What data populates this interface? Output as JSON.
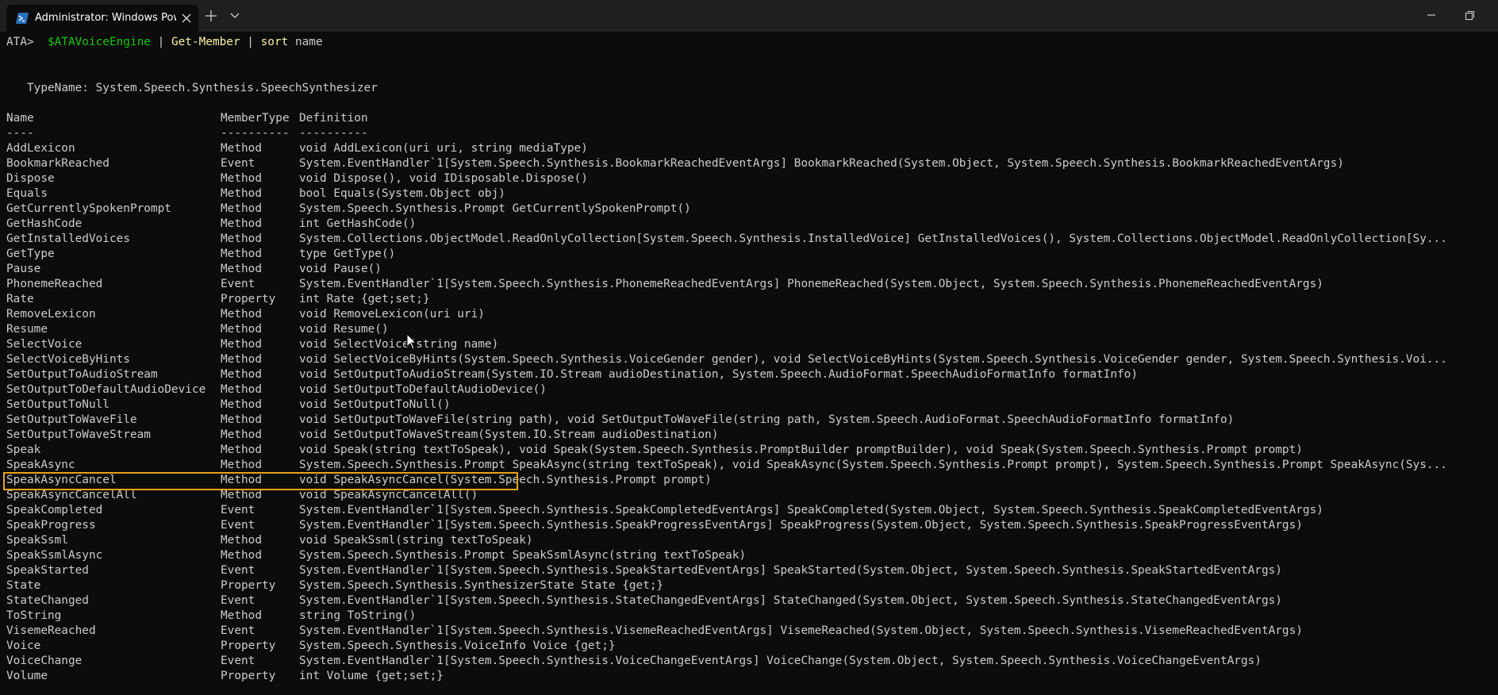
{
  "window": {
    "tab_title": "Administrator: Windows PowerShell",
    "icons": {
      "tab": "powershell-icon",
      "close_tab": "close-icon",
      "new_tab": "plus-icon",
      "dropdown": "chevron-down-icon",
      "minimize": "minimize-icon",
      "maximize": "maximize-icon"
    }
  },
  "command": {
    "prompt": "ATA>",
    "variable": "$ATAVoiceEngine",
    "pipe1": "|",
    "cmdlet1": "Get-Member",
    "pipe2": "|",
    "cmdlet2": "sort",
    "argument": "name"
  },
  "output": {
    "typename": "TypeName: System.Speech.Synthesis.SpeechSynthesizer",
    "headers": {
      "name": "Name",
      "type": "MemberType",
      "definition": "Definition"
    },
    "separators": {
      "name": "----",
      "type": "----------",
      "definition": "----------"
    },
    "rows": [
      {
        "name": "AddLexicon",
        "type": "Method",
        "definition": "void AddLexicon(uri uri, string mediaType)"
      },
      {
        "name": "BookmarkReached",
        "type": "Event",
        "definition": "System.EventHandler`1[System.Speech.Synthesis.BookmarkReachedEventArgs] BookmarkReached(System.Object, System.Speech.Synthesis.BookmarkReachedEventArgs)"
      },
      {
        "name": "Dispose",
        "type": "Method",
        "definition": "void Dispose(), void IDisposable.Dispose()"
      },
      {
        "name": "Equals",
        "type": "Method",
        "definition": "bool Equals(System.Object obj)"
      },
      {
        "name": "GetCurrentlySpokenPrompt",
        "type": "Method",
        "definition": "System.Speech.Synthesis.Prompt GetCurrentlySpokenPrompt()"
      },
      {
        "name": "GetHashCode",
        "type": "Method",
        "definition": "int GetHashCode()"
      },
      {
        "name": "GetInstalledVoices",
        "type": "Method",
        "definition": "System.Collections.ObjectModel.ReadOnlyCollection[System.Speech.Synthesis.InstalledVoice] GetInstalledVoices(), System.Collections.ObjectModel.ReadOnlyCollection[Sy..."
      },
      {
        "name": "GetType",
        "type": "Method",
        "definition": "type GetType()"
      },
      {
        "name": "Pause",
        "type": "Method",
        "definition": "void Pause()"
      },
      {
        "name": "PhonemeReached",
        "type": "Event",
        "definition": "System.EventHandler`1[System.Speech.Synthesis.PhonemeReachedEventArgs] PhonemeReached(System.Object, System.Speech.Synthesis.PhonemeReachedEventArgs)"
      },
      {
        "name": "Rate",
        "type": "Property",
        "definition": "int Rate {get;set;}"
      },
      {
        "name": "RemoveLexicon",
        "type": "Method",
        "definition": "void RemoveLexicon(uri uri)"
      },
      {
        "name": "Resume",
        "type": "Method",
        "definition": "void Resume()"
      },
      {
        "name": "SelectVoice",
        "type": "Method",
        "definition": "void SelectVoice(string name)"
      },
      {
        "name": "SelectVoiceByHints",
        "type": "Method",
        "definition": "void SelectVoiceByHints(System.Speech.Synthesis.VoiceGender gender), void SelectVoiceByHints(System.Speech.Synthesis.VoiceGender gender, System.Speech.Synthesis.Voi..."
      },
      {
        "name": "SetOutputToAudioStream",
        "type": "Method",
        "definition": "void SetOutputToAudioStream(System.IO.Stream audioDestination, System.Speech.AudioFormat.SpeechAudioFormatInfo formatInfo)"
      },
      {
        "name": "SetOutputToDefaultAudioDevice",
        "type": "Method",
        "definition": "void SetOutputToDefaultAudioDevice()"
      },
      {
        "name": "SetOutputToNull",
        "type": "Method",
        "definition": "void SetOutputToNull()"
      },
      {
        "name": "SetOutputToWaveFile",
        "type": "Method",
        "definition": "void SetOutputToWaveFile(string path), void SetOutputToWaveFile(string path, System.Speech.AudioFormat.SpeechAudioFormatInfo formatInfo)"
      },
      {
        "name": "SetOutputToWaveStream",
        "type": "Method",
        "definition": "void SetOutputToWaveStream(System.IO.Stream audioDestination)"
      },
      {
        "name": "Speak",
        "type": "Method",
        "definition": "void Speak(string textToSpeak), void Speak(System.Speech.Synthesis.PromptBuilder promptBuilder), void Speak(System.Speech.Synthesis.Prompt prompt)"
      },
      {
        "name": "SpeakAsync",
        "type": "Method",
        "definition": "System.Speech.Synthesis.Prompt SpeakAsync(string textToSpeak), void SpeakAsync(System.Speech.Synthesis.Prompt prompt), System.Speech.Synthesis.Prompt SpeakAsync(Sys..."
      },
      {
        "name": "SpeakAsyncCancel",
        "type": "Method",
        "definition": "void SpeakAsyncCancel(System.Speech.Synthesis.Prompt prompt)"
      },
      {
        "name": "SpeakAsyncCancelAll",
        "type": "Method",
        "definition": "void SpeakAsyncCancelAll()"
      },
      {
        "name": "SpeakCompleted",
        "type": "Event",
        "definition": "System.EventHandler`1[System.Speech.Synthesis.SpeakCompletedEventArgs] SpeakCompleted(System.Object, System.Speech.Synthesis.SpeakCompletedEventArgs)"
      },
      {
        "name": "SpeakProgress",
        "type": "Event",
        "definition": "System.EventHandler`1[System.Speech.Synthesis.SpeakProgressEventArgs] SpeakProgress(System.Object, System.Speech.Synthesis.SpeakProgressEventArgs)"
      },
      {
        "name": "SpeakSsml",
        "type": "Method",
        "definition": "void SpeakSsml(string textToSpeak)"
      },
      {
        "name": "SpeakSsmlAsync",
        "type": "Method",
        "definition": "System.Speech.Synthesis.Prompt SpeakSsmlAsync(string textToSpeak)"
      },
      {
        "name": "SpeakStarted",
        "type": "Event",
        "definition": "System.EventHandler`1[System.Speech.Synthesis.SpeakStartedEventArgs] SpeakStarted(System.Object, System.Speech.Synthesis.SpeakStartedEventArgs)"
      },
      {
        "name": "State",
        "type": "Property",
        "definition": "System.Speech.Synthesis.SynthesizerState State {get;}"
      },
      {
        "name": "StateChanged",
        "type": "Event",
        "definition": "System.EventHandler`1[System.Speech.Synthesis.StateChangedEventArgs] StateChanged(System.Object, System.Speech.Synthesis.StateChangedEventArgs)"
      },
      {
        "name": "ToString",
        "type": "Method",
        "definition": "string ToString()"
      },
      {
        "name": "VisemeReached",
        "type": "Event",
        "definition": "System.EventHandler`1[System.Speech.Synthesis.VisemeReachedEventArgs] VisemeReached(System.Object, System.Speech.Synthesis.VisemeReachedEventArgs)"
      },
      {
        "name": "Voice",
        "type": "Property",
        "definition": "System.Speech.Synthesis.VoiceInfo Voice {get;}"
      },
      {
        "name": "VoiceChange",
        "type": "Event",
        "definition": "System.EventHandler`1[System.Speech.Synthesis.VoiceChangeEventArgs] VoiceChange(System.Object, System.Speech.Synthesis.VoiceChangeEventArgs)"
      },
      {
        "name": "Volume",
        "type": "Property",
        "definition": "int Volume {get;set;}"
      }
    ],
    "highlighted_member": "Speak"
  },
  "colors": {
    "background": "#0c0c0c",
    "titlebar": "#1f1f1f",
    "text": "#cccccc",
    "variable": "#16c60c",
    "cmdlet": "#f9f1a5",
    "highlight_border": "#e8a317"
  }
}
